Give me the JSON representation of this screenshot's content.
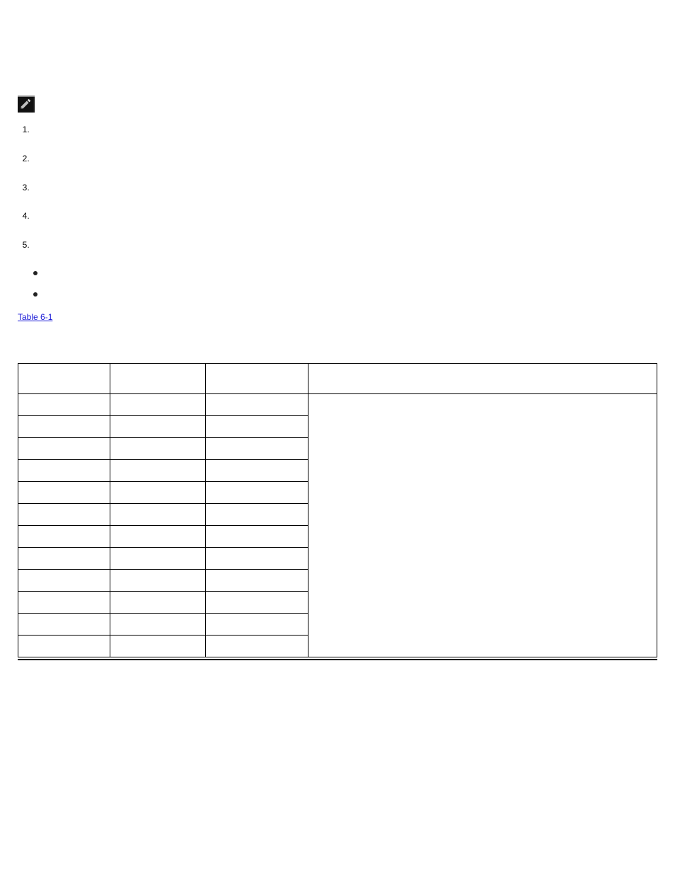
{
  "note": {
    "label": "",
    "text": ""
  },
  "steps": {
    "s1": "",
    "s2": "",
    "s3": "",
    "s4": "",
    "s5": ""
  },
  "bullets": {
    "b1": "",
    "b2": ""
  },
  "para_before_link": "",
  "link_text": "Table 6-1",
  "para_after_link": "",
  "table_heading": "",
  "table": {
    "headers": {
      "h1": "",
      "h2": "",
      "h3": "",
      "h4": ""
    },
    "rows": [
      {
        "c1": "",
        "c2": "",
        "c3": ""
      },
      {
        "c1": "",
        "c2": "",
        "c3": ""
      },
      {
        "c1": "",
        "c2": "",
        "c3": ""
      },
      {
        "c1": "",
        "c2": "",
        "c3": ""
      },
      {
        "c1": "",
        "c2": "",
        "c3": ""
      },
      {
        "c1": "",
        "c2": "",
        "c3": ""
      },
      {
        "c1": "",
        "c2": "",
        "c3": ""
      },
      {
        "c1": "",
        "c2": "",
        "c3": ""
      },
      {
        "c1": "",
        "c2": "",
        "c3": ""
      },
      {
        "c1": "",
        "c2": "",
        "c3": ""
      },
      {
        "c1": "",
        "c2": "",
        "c3": ""
      },
      {
        "c1": "",
        "c2": "",
        "c3": ""
      }
    ],
    "note_cell": ""
  }
}
